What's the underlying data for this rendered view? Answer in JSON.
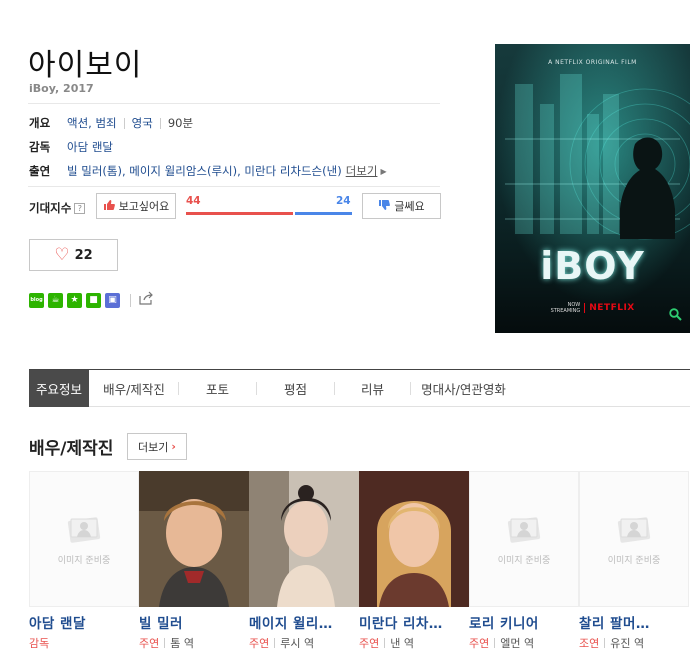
{
  "movie": {
    "title": "아이보이",
    "subtitle": "iBoy, 2017"
  },
  "info": {
    "overview_label": "개요",
    "genre": "액션, 범죄",
    "country": "영국",
    "runtime": "90분",
    "director_label": "감독",
    "director": "아담 랜달",
    "cast_label": "출연",
    "cast_text": "빌 밀러(톰), 메이지 윌리암스(루시), 미란다 리차드슨(낸)",
    "more": "더보기"
  },
  "expect": {
    "label": "기대지수",
    "help": "?",
    "want_button": "보고싶어요",
    "want_count": "44",
    "meh_count": "24",
    "meh_button": "글쎄요",
    "want_ratio": 0.647
  },
  "like": {
    "count": "22"
  },
  "share": {
    "icons": [
      {
        "name": "blog-share-icon",
        "color": "#2db400",
        "glyph": "blog"
      },
      {
        "name": "cafe-share-icon",
        "color": "#2db400",
        "glyph": "☕"
      },
      {
        "name": "bookmark-share-icon",
        "color": "#2db400",
        "glyph": "★"
      },
      {
        "name": "band-share-icon",
        "color": "#2db400",
        "glyph": "■"
      },
      {
        "name": "memo-share-icon",
        "color": "#5b6fd6",
        "glyph": "▣"
      }
    ]
  },
  "poster": {
    "tagline": "A NETFLIX ORIGINAL FILM",
    "logo": "iBOY",
    "streaming": "NOW STREAMING",
    "brand": "NETFLIX"
  },
  "tabs": [
    {
      "label": "주요정보",
      "active": true
    },
    {
      "label": "배우/제작진"
    },
    {
      "label": "포토"
    },
    {
      "label": "평점"
    },
    {
      "label": "리뷰"
    },
    {
      "label": "명대사/연관영화"
    }
  ],
  "cast_section": {
    "title": "배우/제작진",
    "more": "더보기"
  },
  "placeholder_text": "이미지 준비중",
  "cast": [
    {
      "name": "아담 랜달",
      "role": "감독",
      "character": "",
      "photo": "placeholder"
    },
    {
      "name": "빌 밀러",
      "role": "주연",
      "character": "톰 역",
      "photo": "boy"
    },
    {
      "name": "메이지 윌리…",
      "role": "주연",
      "character": "루시 역",
      "photo": "woman-dark"
    },
    {
      "name": "미란다 리차…",
      "role": "주연",
      "character": "낸 역",
      "photo": "woman-blonde"
    },
    {
      "name": "로리 키니어",
      "role": "주연",
      "character": "엘먼 역",
      "photo": "placeholder"
    },
    {
      "name": "찰리 팔머…",
      "role": "조연",
      "character": "유진 역",
      "photo": "placeholder"
    }
  ],
  "colors": {
    "link": "#1f4c8f",
    "accent_red": "#e8514d",
    "accent_blue": "#4a86e8",
    "active_tab": "#4a4a4a"
  }
}
